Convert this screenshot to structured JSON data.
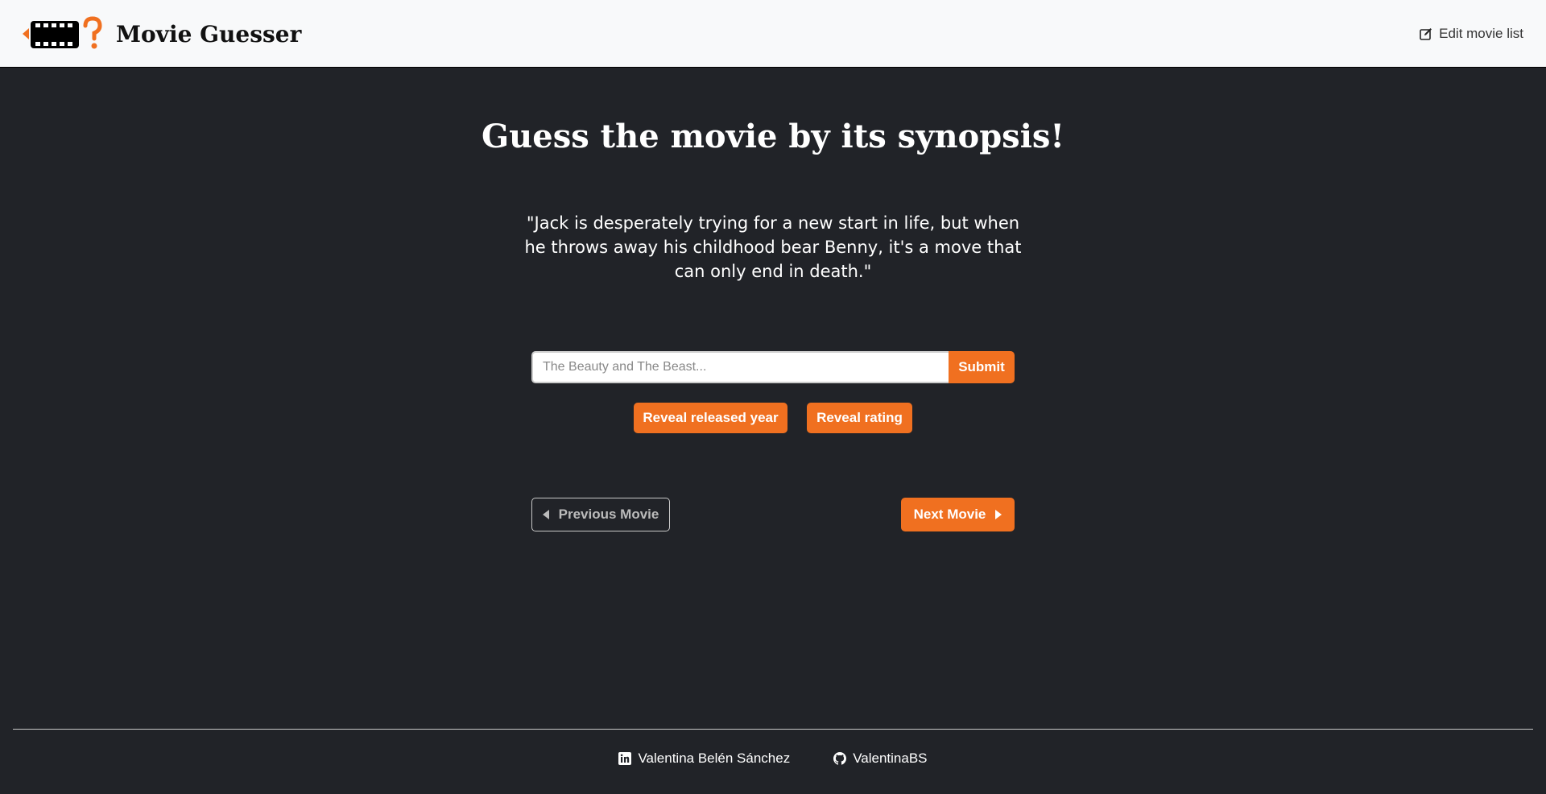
{
  "header": {
    "brand_title": "Movie Guesser",
    "edit_label": "Edit movie list",
    "logo_icon": "film-question-icon",
    "edit_icon": "edit-icon"
  },
  "main": {
    "title": "Guess the movie by its synopsis!",
    "synopsis": "\"Jack is desperately trying for a new start in life, but when he throws away his childhood bear Benny, it's a move that can only end in death.\"",
    "input": {
      "placeholder": "The Beauty and The Beast...",
      "value": ""
    },
    "submit_label": "Submit",
    "reveal_year_label": "Reveal released year",
    "reveal_rating_label": "Reveal rating",
    "prev_label": "Previous Movie",
    "next_label": "Next Movie"
  },
  "footer": {
    "linkedin_label": "Valentina Belén Sánchez",
    "github_label": "ValentinaBS",
    "linkedin_icon": "linkedin-icon",
    "github_icon": "github-icon"
  },
  "colors": {
    "accent": "#f07020",
    "background": "#212328",
    "navbar": "#f8f9fa"
  }
}
